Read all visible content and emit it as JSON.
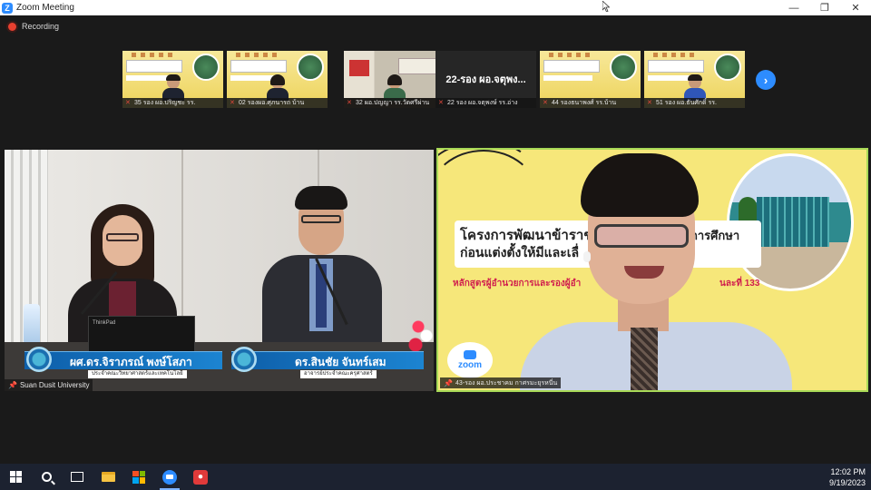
{
  "window": {
    "title": "Zoom Meeting",
    "controls": {
      "minimize": "—",
      "restore": "❐",
      "close": "✕"
    }
  },
  "recording": {
    "label": "Recording"
  },
  "gallery": {
    "thumbnails": [
      {
        "name": "35 รอง ผอ.ปริญชะ รร.",
        "style": "slide"
      },
      {
        "name": "02 รองผอ.ศุภนารถ บ้าน",
        "style": "slide"
      },
      {
        "name": "32 ผอ.ปญญา รร.วัดศรีผ่าน",
        "style": "office"
      },
      {
        "name": "22 รอง ผอ.จตุพงษ์ รร.อ่าง",
        "style": "plain",
        "display": "22-รอง ผอ.จตุพง..."
      },
      {
        "name": "44 รองธนาพงศ์ รร.บ้าน",
        "style": "slide"
      },
      {
        "name": "51 รอง ผอ.ธันศักดิ์ รร.",
        "style": "blue"
      }
    ],
    "next_label": "›"
  },
  "left_video": {
    "speaker1_name": "ผศ.ดร.จิราภรณ์ พงษ์โสภา",
    "speaker1_title": "ประจำคณะวิทยาศาสตร์และเทคโนโลยี",
    "speaker2_name": "ดร.สินชัย จันทร์เสม",
    "speaker2_title": "อาจารย์ประจำคณะครุศาสตร์",
    "laptop_brand": "ThinkPad",
    "participant_name": "Suan Dusit University"
  },
  "right_video": {
    "title_line1": "โครงการพัฒนาข้าราช",
    "title_line1_end": "การศึกษา",
    "title_line2": "ก่อนแต่งตั้งให้มีและเลื่",
    "subtitle": "หลักสูตรผู้อำนวยการและรองผู้อำ",
    "subtitle_end": "นละที่ 133",
    "zoom_badge": "zoom",
    "participant_name": "43-รอง ผอ.ประชาคม กาศรมะยุรหนี่น"
  },
  "taskbar": {
    "time": "12:02 PM",
    "date": "9/19/2023"
  },
  "icons": {
    "mic_off": "✕",
    "pin": "📌"
  }
}
